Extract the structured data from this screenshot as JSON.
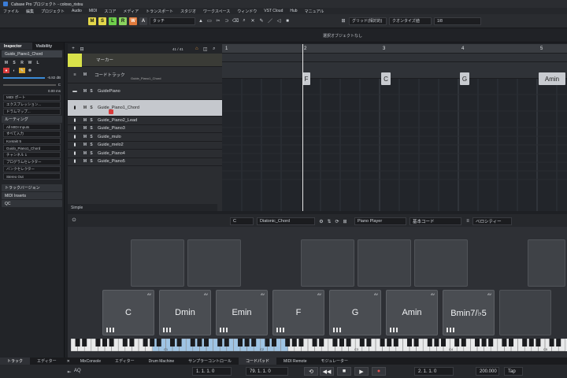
{
  "window": {
    "title": "Cubase Pro プロジェクト - coloso_ristsu"
  },
  "menu": [
    "ファイル",
    "編集",
    "プロジェクト",
    "Audio",
    "MIDI",
    "スコア",
    "メディア",
    "トランスポート",
    "スタジオ",
    "ワークスペース",
    "ウィンドウ",
    "VST Cloud",
    "Hub",
    "マニュアル"
  ],
  "toolbar": {
    "modes": [
      "M",
      "S",
      "L",
      "R",
      "W",
      "A"
    ],
    "automation_mode": "タッチ",
    "grid_type": "グリッド(相対的)",
    "quantize_label": "クオンタイズ値",
    "quantize_value": "1/8"
  },
  "statusline": {
    "message": "選択オブジェクトなし"
  },
  "inspector": {
    "tabs": [
      "Inspector",
      "Visibility"
    ],
    "track_name": "Guido_Piano1_Chord",
    "volume": "-6.82 dB",
    "pan": "C",
    "delay": "0.00 ms",
    "midi_port": "MIDI ポート",
    "expression": "エクスプレッション...",
    "drum_map": "ドラムマップ...",
    "routing_label": "ルーティング",
    "input": "All MIDI Inputs",
    "output_short": "すべて入力",
    "instrument": "Kontakt 5",
    "channel_target": "Guido_Piano1_Chord",
    "channel": "チャンネル 1",
    "program": "プログラムセレクター",
    "bank": "バンクセレクター",
    "output": "Stereo Out",
    "sections": [
      "トラックバージョン",
      "MIDI Inserts",
      "QC"
    ]
  },
  "tracklist": {
    "counter": "41 / 41",
    "marker_label": "マーカー",
    "chord_label": "コードトラック",
    "chord_sub": "Guide_Piano1_Chord",
    "folder": "GuidePiano",
    "tracks": [
      "Guide_Piano1_Chord",
      "Guide_Piano2_Lead",
      "Guide_Piano3",
      "Guide_mulo",
      "Guide_melo2",
      "Guide_Piano4",
      "Guide_Piano5"
    ],
    "footer": "Simple"
  },
  "arrange": {
    "ruler": [
      "1",
      "2",
      "3",
      "4",
      "5"
    ],
    "chord_events": [
      "F",
      "C",
      "G",
      "Amin"
    ]
  },
  "chordpads": {
    "root": "C",
    "scale": "Diatonic_Chord",
    "player": "Piano Player",
    "mode": "基本コード",
    "voicing": "ベロシティー",
    "pad_av": "AV",
    "chords": [
      "C",
      "Dmin",
      "Emin",
      "F",
      "G",
      "Amin",
      "Bmin7/♭5"
    ],
    "octave_labels": [
      "C1",
      "C2",
      "C3",
      "C4",
      "C5"
    ]
  },
  "bottom_tabs": [
    "トラック",
    "エディター",
    "MixConsole",
    "エディター",
    "Drum Machine",
    "サンプラーコントロール",
    "コードパッド",
    "MIDI Remote",
    "モジュレーター"
  ],
  "transport": {
    "left_locator": "1. 1. 1. 0",
    "right_locator": "79. 1. 1. 0",
    "position": "2. 1. 1. 0",
    "tempo": "200.000",
    "tap": "Tap",
    "aq": "AQ"
  }
}
